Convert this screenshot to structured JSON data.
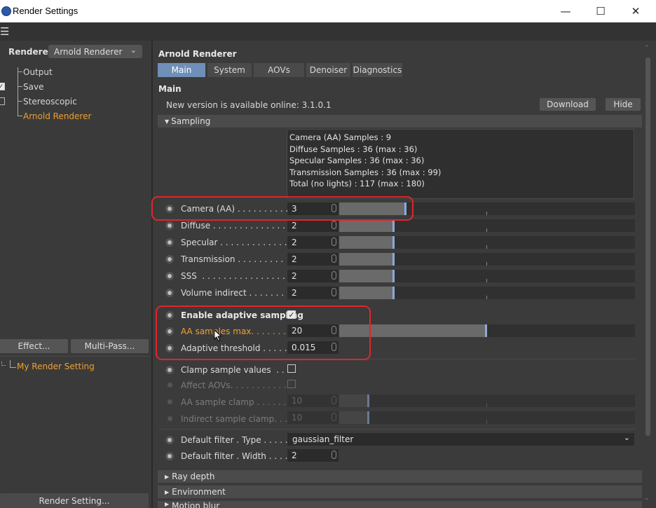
{
  "window": {
    "title": "Render Settings",
    "minimize": "—",
    "maximize": "☐",
    "close": "✕"
  },
  "menubar": {
    "menu_icon": "☰"
  },
  "left": {
    "renderer_label": "Renderer",
    "renderer_value": "Arnold Renderer",
    "tree": [
      {
        "label": "Output"
      },
      {
        "label": "Save"
      },
      {
        "label": "Stereoscopic"
      },
      {
        "label": "Arnold Renderer"
      }
    ],
    "effect_button": "Effect...",
    "multipass_button": "Multi-Pass...",
    "render_setting_item": "My Render Setting",
    "render_setting_button": "Render Setting..."
  },
  "right": {
    "header": "Arnold Renderer",
    "tabs": [
      "Main",
      "System",
      "AOVs",
      "Denoiser",
      "Diagnostics"
    ],
    "active_tab": "Main",
    "section": "Main",
    "update_text": "New version is available online: 3.1.0.1",
    "download_button": "Download",
    "hide_button": "Hide",
    "sampling_group": "Sampling",
    "stats": [
      "Camera (AA) Samples : 9",
      "Diffuse Samples : 36 (max : 36)",
      "Specular Samples : 36 (max : 36)",
      "Transmission Samples : 36 (max : 99)",
      "Total (no lights) : 117 (max : 180)"
    ],
    "samples": [
      {
        "label": "Camera (AA) . . . . . . . . . .",
        "value": "3",
        "level": 0.22
      },
      {
        "label": "Diffuse . . . . . . . . . . . . . . .",
        "value": "2",
        "level": 0.18
      },
      {
        "label": "Specular . . . . . . . . . . . . . .",
        "value": "2",
        "level": 0.18
      },
      {
        "label": "Transmission . . . . . . . . .",
        "value": "2",
        "level": 0.18
      },
      {
        "label": "SSS  . . . . . . . . . . . . . . . .",
        "value": "2",
        "level": 0.18
      },
      {
        "label": "Volume indirect . . . . . . . .",
        "value": "2",
        "level": 0.18
      }
    ],
    "adaptive": {
      "enable_label": "Enable adaptive sampling",
      "aa_max_label": "AA samples max. . . . . . . .",
      "aa_max_value": "20",
      "aa_max_level": 0.5,
      "threshold_label": "Adaptive threshold . . . . . .",
      "threshold_value": "0.015"
    },
    "clamp": {
      "clamp_label": "Clamp sample values  . . . .",
      "affect_label": "Affect AOVs. . . . . . . . . . .",
      "aa_clamp_label": "AA sample clamp . . . . . . .",
      "aa_clamp_value": "10",
      "indirect_clamp_label": "Indirect sample clamp. . . .",
      "indirect_clamp_value": "10"
    },
    "filter": {
      "type_label": "Default filter . Type . . . . . .",
      "type_value": "gaussian_filter",
      "width_label": "Default filter . Width . . . . .",
      "width_value": "2"
    },
    "groups": [
      "Ray depth",
      "Environment",
      "Motion blur"
    ]
  }
}
